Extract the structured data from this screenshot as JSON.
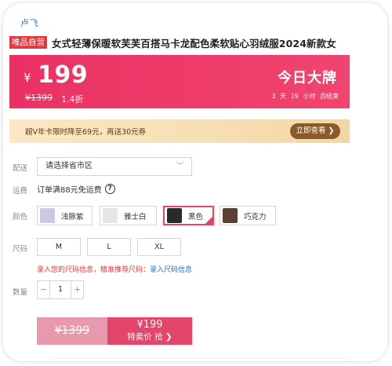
{
  "brand": {
    "logo_text": "卢飞"
  },
  "product": {
    "tag": "唯品自营",
    "title": "女式轻薄保暖软芙芙百搭马卡龙配色柔软贴心羽绒服2024新款女"
  },
  "price": {
    "currency": "¥",
    "value": "199",
    "original": "¥1399",
    "discount": "1.4折",
    "daily_label": "今日大牌",
    "countdown": "3 天 19 小时 后结束"
  },
  "vip": {
    "text": "超V年卡限时降至69元，再送30元券",
    "button": "立即查看 ❯"
  },
  "form": {
    "delivery_label": "配送",
    "delivery_placeholder": "请选择省市区",
    "shipping_label": "运费",
    "shipping_text": "订单满88元免运费",
    "color_label": "颜色",
    "colors": [
      {
        "name": "浅豚紫",
        "swatch": "#cfc6e2"
      },
      {
        "name": "雅士白",
        "swatch": "#e9e6e1"
      },
      {
        "name": "黑色",
        "swatch": "#2a2a2a",
        "selected": true
      },
      {
        "name": "巧克力",
        "swatch": "#5a4034"
      }
    ],
    "size_label": "尺码",
    "sizes": [
      "M",
      "L",
      "XL"
    ],
    "size_hint": "录入您的尺码信息，精准推荐尺码：",
    "size_link": "录入尺码信息",
    "qty_label": "数量",
    "qty_minus": "−",
    "qty_value": "1",
    "qty_plus": "+"
  },
  "buy": {
    "original": "¥1399",
    "price": "¥199",
    "label": "特卖价 抢 ❯"
  },
  "colors": {
    "accent": "#e4466a",
    "tag_red": "#e4393c",
    "vip_gold": "#8a5a2b",
    "link_blue": "#2b6cc4"
  }
}
